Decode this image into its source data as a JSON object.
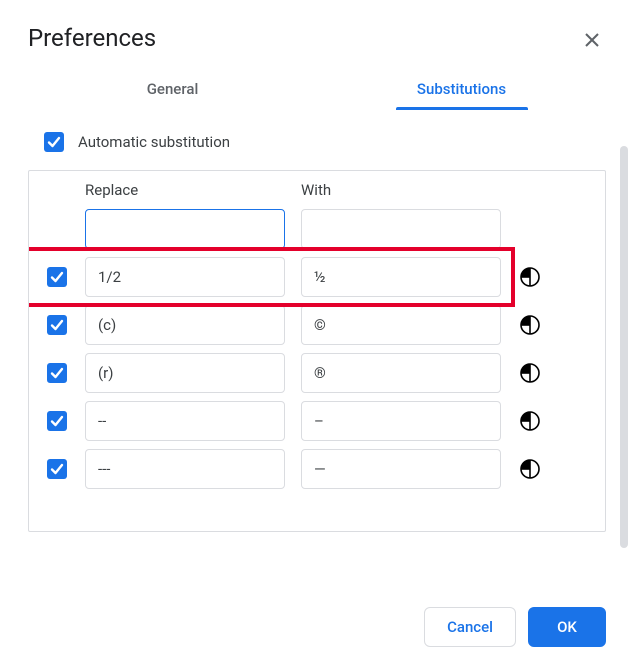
{
  "dialog": {
    "title": "Preferences",
    "tabs": {
      "general": "General",
      "substitutions": "Substitutions",
      "active": "substitutions"
    },
    "auto_substitution": {
      "label": "Automatic substitution",
      "checked": true
    },
    "columns": {
      "replace": "Replace",
      "with": "With"
    },
    "rows": [
      {
        "checked": null,
        "replace": "",
        "with": "",
        "focused": true,
        "shared": false
      },
      {
        "checked": true,
        "replace": "1/2",
        "with": "½",
        "shared": true,
        "highlighted": true
      },
      {
        "checked": true,
        "replace": "(c)",
        "with": "©",
        "shared": true
      },
      {
        "checked": true,
        "replace": "(r)",
        "with": "®",
        "shared": true
      },
      {
        "checked": true,
        "replace": "--",
        "with": "–",
        "shared": true
      },
      {
        "checked": true,
        "replace": "---",
        "with": "—",
        "shared": true
      }
    ],
    "buttons": {
      "cancel": "Cancel",
      "ok": "OK"
    }
  }
}
